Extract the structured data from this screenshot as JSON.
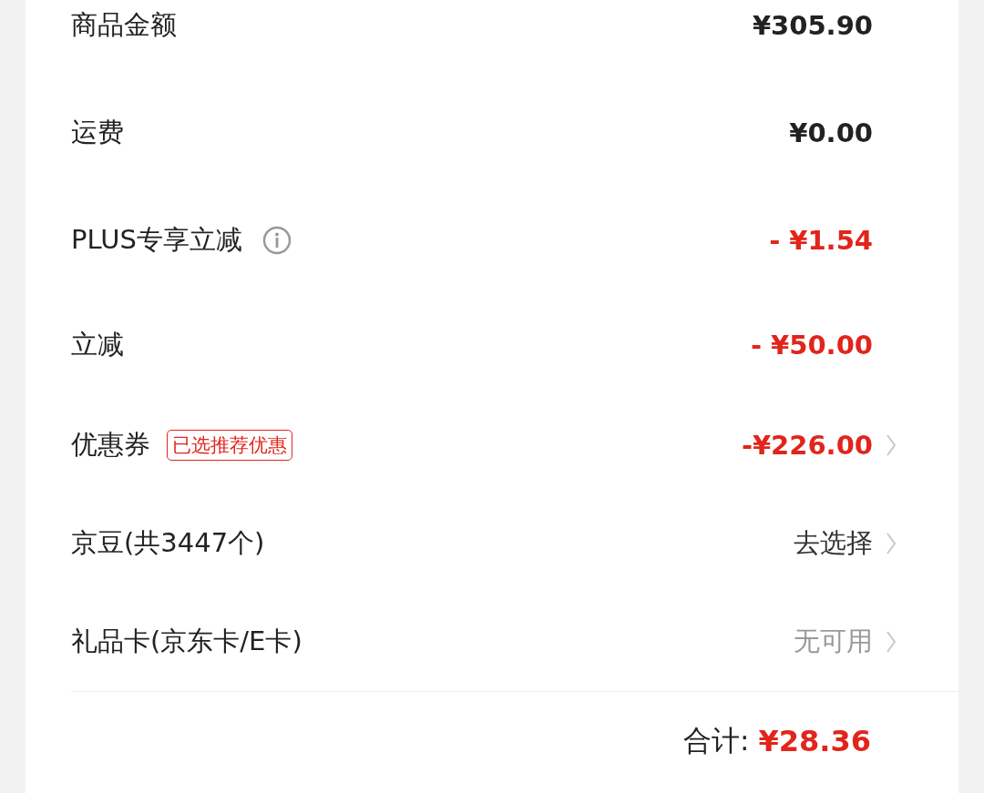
{
  "rows": [
    {
      "label": "商品金额",
      "info": false,
      "value": "¥305.90",
      "kind": "dark",
      "chevron": false
    },
    {
      "label": "运费",
      "info": false,
      "value": "¥0.00",
      "kind": "dark",
      "chevron": false
    },
    {
      "label": "PLUS专享立减",
      "info": true,
      "value": "- ¥1.54",
      "kind": "red",
      "chevron": false
    },
    {
      "label": "立减",
      "info": false,
      "value": "- ¥50.00",
      "kind": "red",
      "chevron": false
    },
    {
      "label": "优惠券",
      "info": false,
      "tag": "已选推荐优惠",
      "value": "-¥226.00",
      "kind": "red",
      "chevron": true
    },
    {
      "label": "京豆(共3447个)",
      "info": false,
      "value": "去选择",
      "kind": "action",
      "chevron": true
    },
    {
      "label": "礼品卡(京东卡/E卡)",
      "info": false,
      "value": "无可用",
      "kind": "muted",
      "chevron": true
    }
  ],
  "total": {
    "label": "合计:",
    "value": "¥28.36"
  }
}
